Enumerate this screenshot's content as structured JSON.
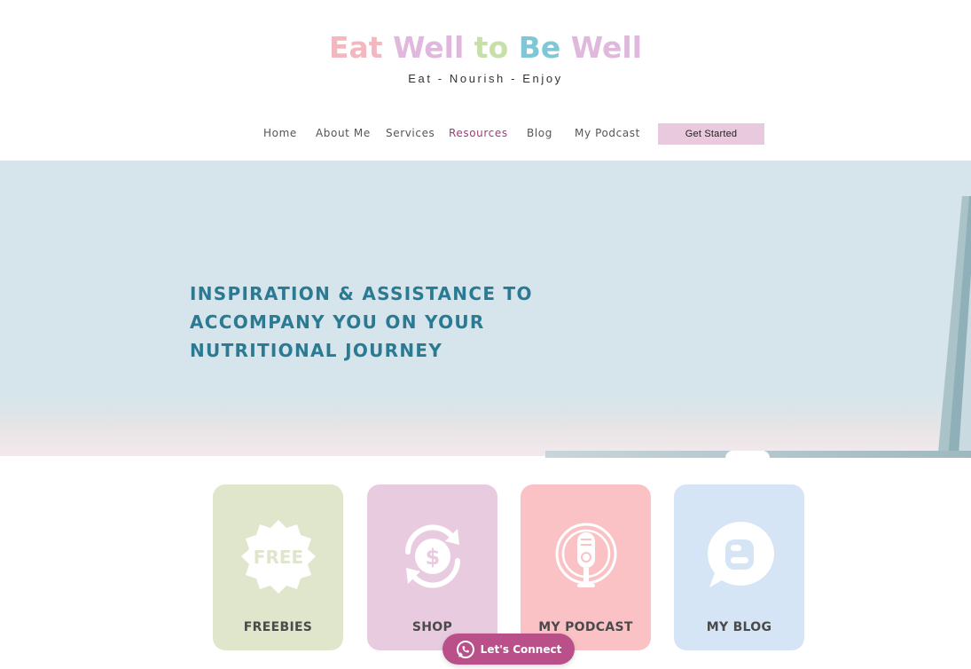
{
  "header": {
    "logo_words": [
      {
        "text": "Eat",
        "color": "#f3b7c0"
      },
      {
        "text": "Well",
        "color": "#e1b8dd"
      },
      {
        "text": "to",
        "color": "#c6e0a8"
      },
      {
        "text": "Be",
        "color": "#7fc7d6"
      },
      {
        "text": "Well",
        "color": "#e1b8dd"
      }
    ],
    "tagline": "Eat - Nourish - Enjoy"
  },
  "nav": {
    "items": [
      {
        "label": "Home"
      },
      {
        "label": "About Me"
      },
      {
        "label": "Services"
      },
      {
        "label": "Resources",
        "active": true
      },
      {
        "label": "Blog"
      },
      {
        "label": "My Podcast"
      }
    ],
    "cta_label": "Get Started",
    "active_color": "#9a3d7c",
    "cta_color": "#e9c9de"
  },
  "hero": {
    "headline": "INSPIRATION & ASSISTANCE TO ACCOMPANY YOU ON YOUR NUTRITIONAL JOURNEY",
    "text_color": "#2b7a93",
    "bg_color": "#d6e5eb"
  },
  "cards": [
    {
      "label": "FREEBIES",
      "icon": "free-badge-icon",
      "icon_text": "FREE",
      "bg": "#dfe6cc"
    },
    {
      "label": "SHOP",
      "icon": "dollar-cycle-icon",
      "bg": "#e9cbe0"
    },
    {
      "label": "MY PODCAST",
      "icon": "microphone-icon",
      "bg": "#fbc2c6"
    },
    {
      "label": "MY BLOG",
      "icon": "blogger-icon",
      "bg": "#d6e5f5"
    }
  ],
  "connect_button": {
    "label": "Let's Connect",
    "icon": "whatsapp-icon",
    "color": "#b9508a"
  }
}
